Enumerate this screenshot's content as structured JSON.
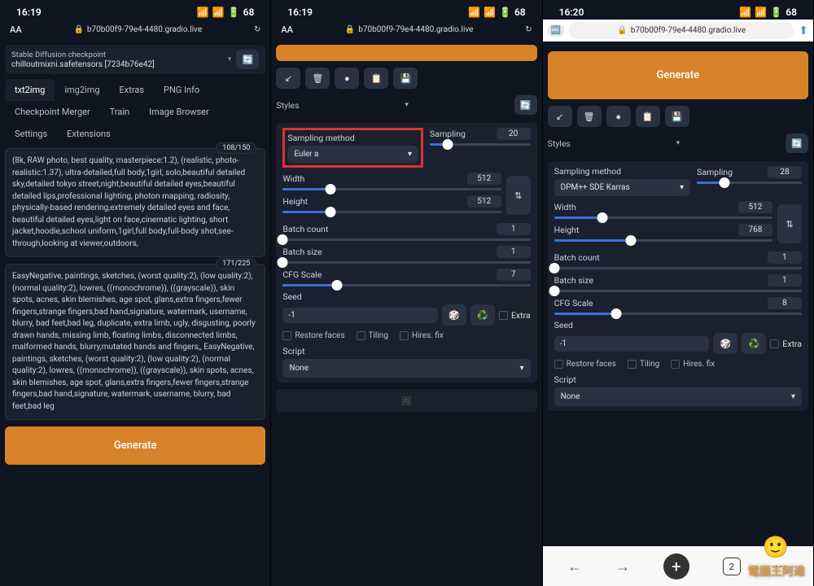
{
  "status": {
    "time1": "16:19",
    "time2": "16:19",
    "time3": "16:20",
    "battery": "68"
  },
  "url": "b70b00f9-79e4-4480.gradio.live",
  "checkpoint": {
    "label": "Stable Diffusion checkpoint",
    "value": "chilloutmixni.safetensors [7234b76e42]"
  },
  "tabs": [
    "txt2img",
    "img2img",
    "Extras",
    "PNG Info",
    "Checkpoint Merger",
    "Train",
    "Image Browser",
    "Settings",
    "Extensions"
  ],
  "prompt": {
    "count": "108/150",
    "text": "(8k, RAW photo, best quality, masterpiece:1.2), (realistic, photo-realistic:1.37), ultra-detailed,full body,1girl, solo,beautiful detailed sky,detailed tokyo street,night,beautiful detailed eyes,beautiful detailed lips,professional lighting, photon mapping, radiosity, physically-based rendering,extremely detailed eyes and face, beautiful detailed eyes,light on face,cinematic lighting, short jacket,hoodie,school uniform,1girl,full body,full-body shot,see-through,looking at viewer,outdoors,"
  },
  "neg": {
    "count": "171/225",
    "text": "EasyNegative, paintings, sketches, (worst quality:2), (low quality:2), (normal quality:2), lowres, ((monochrome)), ((grayscale)), skin spots, acnes, skin blemishes, age spot, glans,extra fingers,fewer fingers,strange fingers,bad hand,signature, watermark, username, blurry, bad feet,bad leg, duplicate, extra limb, ugly, disgusting, poorly drawn hands, missing limb, floating limbs, disconnected limbs, malformed hands, blurry,mutated hands and fingers,, EasyNegative, paintings, sketches, (worst quality:2), (low quality:2), (normal quality:2), lowres, ((monochrome)), ((grayscale)), skin spots, acnes, skin blemishes, age spot, glans,extra fingers,fewer fingers,strange fingers,bad hand,signature, watermark, username, blurry, bad feet,bad leg"
  },
  "generate": "Generate",
  "styles": "Styles",
  "p2": {
    "sampling_label": "Sampling method",
    "sampling_val": "Euler a",
    "steps_label": "Sampling",
    "steps_val": "20",
    "width_label": "Width",
    "width_val": "512",
    "height_label": "Height",
    "height_val": "512",
    "batch_count_label": "Batch count",
    "batch_count_val": "1",
    "batch_size_label": "Batch size",
    "batch_size_val": "1",
    "cfg_label": "CFG Scale",
    "cfg_val": "7",
    "seed_label": "Seed",
    "seed_val": "-1",
    "extra": "Extra",
    "restore": "Restore faces",
    "tiling": "Tiling",
    "hires": "Hires. fix",
    "script_label": "Script",
    "script_val": "None"
  },
  "p3": {
    "sampling_label": "Sampling method",
    "sampling_val": "DPM++ SDE Karras",
    "steps_label": "Sampling",
    "steps_val": "28",
    "width_label": "Width",
    "width_val": "512",
    "height_label": "Height",
    "height_val": "768",
    "batch_count_label": "Batch count",
    "batch_count_val": "1",
    "batch_size_label": "Batch size",
    "batch_size_val": "1",
    "cfg_label": "CFG Scale",
    "cfg_val": "8",
    "seed_label": "Seed",
    "seed_val": "-1",
    "extra": "Extra",
    "restore": "Restore faces",
    "tiling": "Tiling",
    "hires": "Hires. fix",
    "script_label": "Script",
    "script_val": "None"
  },
  "nav_tabs": "2",
  "watermark": "電腦王阿達"
}
